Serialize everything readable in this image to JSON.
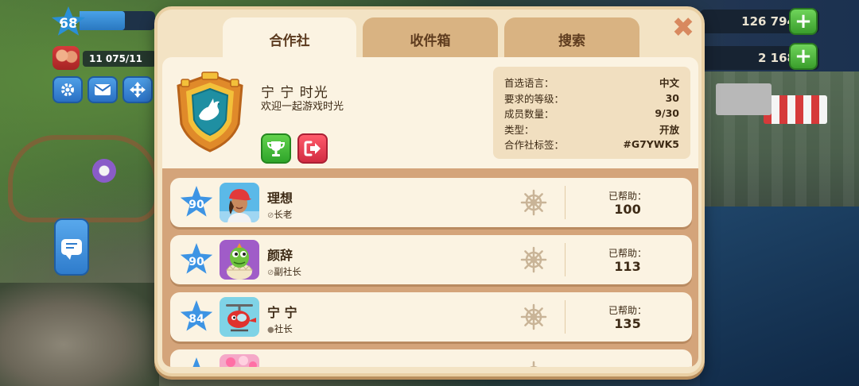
{
  "hud": {
    "level": "68",
    "population": "11 075/11",
    "coins": "126 794",
    "cash": "2 168",
    "plus_symbol": "+"
  },
  "dialog": {
    "tabs": [
      {
        "label": "合作社",
        "active": true
      },
      {
        "label": "收件箱",
        "active": false
      },
      {
        "label": "搜索",
        "active": false
      }
    ],
    "close_symbol": "✖"
  },
  "club": {
    "name": "宁 宁 时光",
    "description": "欢迎一起游戏时光",
    "emblem_icon": "dove-icon",
    "info": [
      {
        "label": "首选语言：",
        "value": "中文"
      },
      {
        "label": "要求的等级：",
        "value": "30"
      },
      {
        "label": "成员数量：",
        "value": "9/30"
      },
      {
        "label": "类型：",
        "value": "开放"
      },
      {
        "label": "合作社标签：",
        "value": "#G7YWK5"
      }
    ]
  },
  "members": [
    {
      "level": "90",
      "name": "理想",
      "role": "长老",
      "help_label": "已帮助：",
      "helped": "100",
      "avatar": "girl-avatar"
    },
    {
      "level": "90",
      "name": "颜辞",
      "role": "副社长",
      "help_label": "已帮助：",
      "helped": "113",
      "avatar": "dinosaur-avatar"
    },
    {
      "level": "84",
      "name": "宁 宁",
      "role": "社长",
      "help_label": "已帮助：",
      "helped": "135",
      "avatar": "helicopter-avatar"
    },
    {
      "level": "",
      "name": "",
      "role": "",
      "help_label": "",
      "helped": "",
      "avatar": "flowers-avatar"
    }
  ],
  "colors": {
    "panel_bg": "#fbf3e2",
    "list_bg": "#d4a47a",
    "level_star": "#3d94e4",
    "accent_green": "#3a9e2c",
    "accent_red": "#d22c42"
  }
}
